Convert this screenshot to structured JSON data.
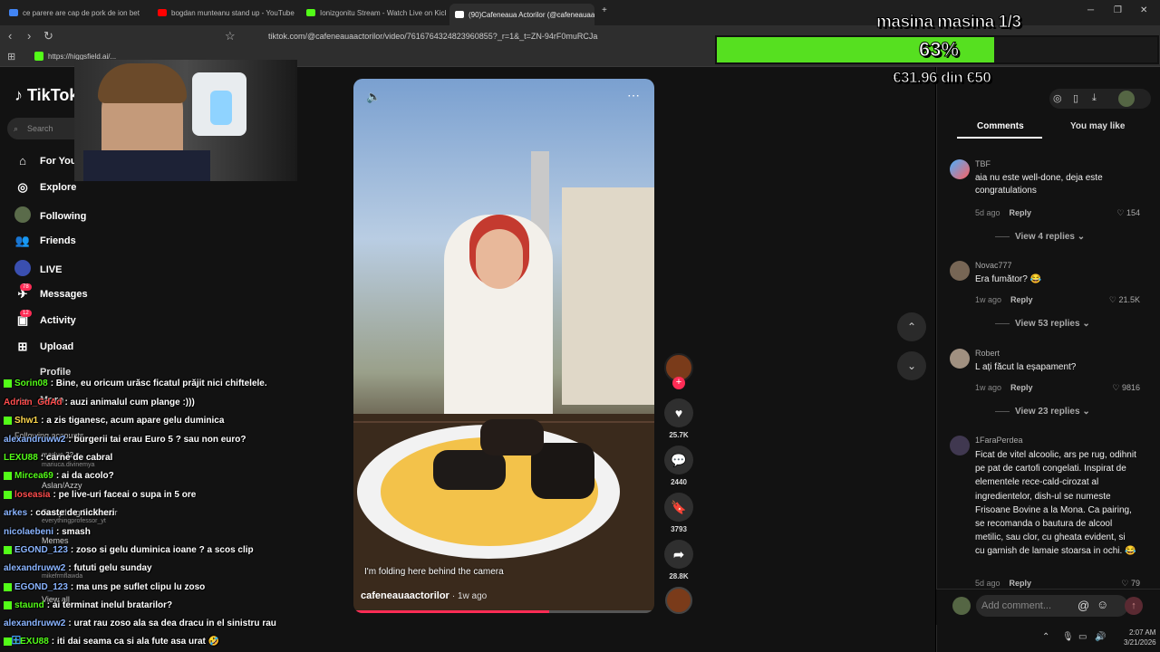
{
  "browser": {
    "tabs": [
      {
        "title": "ce parere are cap de pork de ion bet",
        "color": "#4285f4"
      },
      {
        "title": "bogdan munteanu stand up - YouTube",
        "color": "#ff0000"
      },
      {
        "title": "Ionizgonitu Stream - Watch Live on Kick",
        "color": "#53fc18"
      },
      {
        "title": "(90)Cafeneaua Actorilor (@cafeneauaactorilor)",
        "color": "#ffffff"
      }
    ],
    "new_tab": "+",
    "url": "tiktok.com/@cafeneauaactorilor/video/7616764324823960855?_r=1&_t=ZN-94rF0muRCJa",
    "bookmark": "https://higgsfield.ai/..."
  },
  "goal": {
    "title": "masina masina 1/3",
    "percent_label": "63%",
    "percent": 63,
    "amount": "€31.96 din €50",
    "color": "#56e020"
  },
  "tiktok": {
    "logo": "TikTok",
    "search_placeholder": "Search",
    "nav": [
      {
        "label": "For You",
        "icon": "home-icon"
      },
      {
        "label": "Explore",
        "icon": "compass-icon"
      },
      {
        "label": "Following",
        "icon": "avatar-icon"
      },
      {
        "label": "Friends",
        "icon": "friends-icon"
      },
      {
        "label": "LIVE",
        "icon": "live-icon"
      },
      {
        "label": "Messages",
        "icon": "messages-icon",
        "badge": "78"
      },
      {
        "label": "Activity",
        "icon": "activity-icon",
        "badge": "12"
      },
      {
        "label": "Upload",
        "icon": "upload-icon"
      },
      {
        "label": "Profile",
        "icon": "profile-icon"
      },
      {
        "label": "More",
        "icon": "more-icon"
      }
    ],
    "following_header": "Following accounts",
    "following": [
      {
        "name": "marius.32.x",
        "sub": "marius.32.x"
      },
      {
        "name": "mariuca.divinemya",
        "sub": "mariuca.divinemya"
      },
      {
        "name": "Aslan/Azzy",
        "sub": "aslanazzy"
      },
      {
        "name": "Everything Professor",
        "sub": "everythingprofessor_yt"
      },
      {
        "name": "Memes",
        "sub": "memes"
      },
      {
        "name": "mikefrmflawda",
        "sub": "mikefrmflawda"
      }
    ],
    "view_all": "View all",
    "video": {
      "caption": "I'm folding here behind the camera",
      "author": "cafeneauaactorilor",
      "age": "· 1w ago",
      "volume_icon": "volume-icon",
      "more_icon": "more-icon",
      "progress": 0.65
    },
    "actions": [
      {
        "icon": "heart-icon",
        "count": "25.7K"
      },
      {
        "icon": "comment-icon",
        "count": "2440"
      },
      {
        "icon": "bookmark-icon",
        "count": "3793"
      },
      {
        "icon": "share-icon",
        "count": "28.8K"
      }
    ],
    "comments_tabs": [
      "Comments",
      "You may like"
    ],
    "comments": [
      {
        "user": "TBF",
        "text": "aia nu este well-done, deja este congratulations",
        "age": "5d ago",
        "reply": "Reply",
        "likes": "154",
        "replies": "View 4 replies"
      },
      {
        "user": "Novac777",
        "text": "Era fumător? 😂",
        "age": "1w ago",
        "reply": "Reply",
        "likes": "21.5K",
        "replies": "View 53 replies"
      },
      {
        "user": "Robert",
        "text": "L ați făcut la eșapament?",
        "age": "1w ago",
        "reply": "Reply",
        "likes": "9816",
        "replies": "View 23 replies"
      },
      {
        "user": "1FaraPerdea",
        "text": "Ficat de vitel alcoolic, ars pe rug, odihnit pe pat de cartofi congelati. Inspirat de elementele rece-cald-cirozat al ingredientelor, dish-ul se numeste Frisoane Bovine a la Mona. Ca pairing, se recomanda o bautura de alcool metilic, sau clor, cu gheata evident, si cu garnish de lamaie stoarsa in ochi. 😂",
        "age": "5d ago",
        "reply": "Reply",
        "likes": "79"
      }
    ],
    "add_comment_placeholder": "Add comment..."
  },
  "chat": [
    {
      "user": "Sorin08",
      "color": "#53fc18",
      "msg": ": Bine, eu oricum urăsc ficatul prăjit nici chiftelele."
    },
    {
      "user": "Adrian_GdAd",
      "color": "#ff4d4d",
      "msg": ": auzi animalul cum plange :)))"
    },
    {
      "user": "Shw1",
      "color": "#ffd84d",
      "msg": ": a zis tiganesc, acum apare gelu duminica"
    },
    {
      "user": "alexandruww2",
      "color": "#8ab4ff",
      "msg": ": burgerii tai erau Euro 5 ? sau non euro?"
    },
    {
      "user": "LEXU88",
      "color": "#53fc18",
      "msg": ": carne de cabral"
    },
    {
      "user": "Mircea69",
      "color": "#53fc18",
      "msg": ": ai da acolo?"
    },
    {
      "user": "loseasia",
      "color": "#ff4d4d",
      "msg": ": pe live-uri faceai o supa in 5 ore"
    },
    {
      "user": "arkes",
      "color": "#8ab4ff",
      "msg": ": coaste de nickheri"
    },
    {
      "user": "nicolaebeni",
      "color": "#8ab4ff",
      "msg": ": smash"
    },
    {
      "user": "EGOND_123",
      "color": "#8ab4ff",
      "msg": ": zoso si gelu duminica ioane ? a scos clip"
    },
    {
      "user": "alexandruww2",
      "color": "#8ab4ff",
      "msg": ": fututi gelu sunday"
    },
    {
      "user": "EGOND_123",
      "color": "#8ab4ff",
      "msg": ": ma uns pe suflet clipu lu zoso"
    },
    {
      "user": "staund",
      "color": "#53fc18",
      "msg": ": ai terminat inelul bratarilor?"
    },
    {
      "user": "alexandruww2",
      "color": "#8ab4ff",
      "msg": ": urat rau zoso ala sa dea dracu in el sinistru rau"
    },
    {
      "user": "LEXU88",
      "color": "#53fc18",
      "msg": ": iti dai seama ca si ala fute asa urat 🤣"
    }
  ],
  "taskbar": {
    "time": "2:07 AM",
    "date": "3/21/2026"
  }
}
